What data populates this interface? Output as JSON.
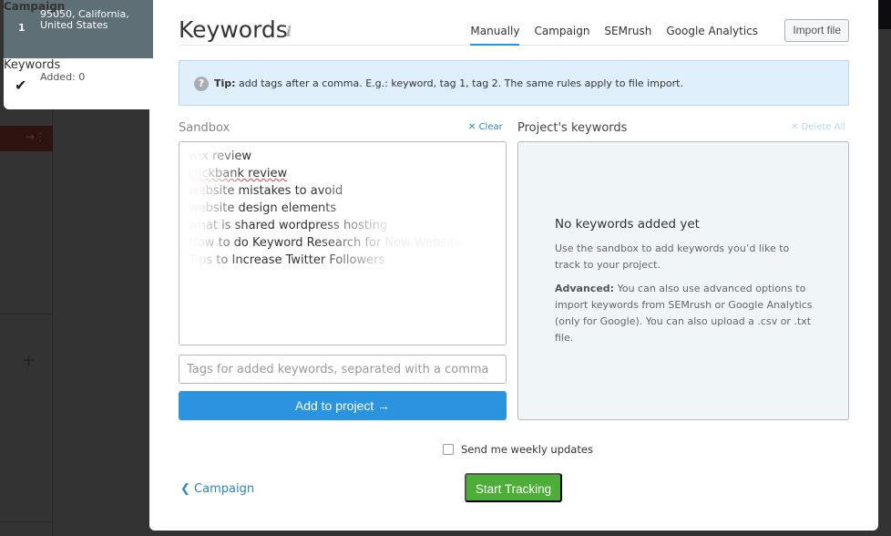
{
  "steps": [
    {
      "number": "1",
      "title": "Campaign",
      "subtitle_line1": "95050, California,",
      "subtitle_line2": "United States"
    },
    {
      "icon": "checkmark-icon",
      "title": "Keywords",
      "subtitle": "Added: 0"
    }
  ],
  "header": {
    "title": "Keywords",
    "info_icon": "i",
    "tabs": [
      {
        "label": "Manually",
        "active": true
      },
      {
        "label": "Campaign",
        "active": false
      },
      {
        "label": "SEMrush",
        "active": false
      },
      {
        "label": "Google Analytics",
        "active": false
      }
    ],
    "import_label": "Import file"
  },
  "tip": {
    "icon": "?",
    "bold": "Tip:",
    "text": " add tags after a comma. E.g.: keyword, tag 1, tag 2. The same rules apply to file import."
  },
  "sandbox": {
    "label": "Sandbox",
    "clear_label": "Clear",
    "keywords": [
      "wix review",
      "clickbank review",
      "website mistakes to avoid",
      "website design elements",
      "what is shared wordpress hosting",
      "How to do Keyword Research for New Website",
      "Tips to Increase Twitter Followers"
    ],
    "tags_placeholder": "Tags for added keywords, separated with a comma",
    "tags_value": "",
    "add_label": "Add to project",
    "add_icon": "→"
  },
  "project": {
    "label": "Project's keywords",
    "delete_all_label": "Delete All",
    "empty_title": "No keywords added yet",
    "empty_text": "Use the sandbox to add keywords you’d like to track to your project.",
    "advanced_bold": "Advanced:",
    "advanced_text": " You can also use advanced options to import keywords from SEMrush or Google Analytics (only for Google). You can also upload a .csv or .txt file."
  },
  "footer": {
    "weekly_label": "Send me weekly updates",
    "weekly_checked": false,
    "back_label": "Campaign",
    "start_label": "Start Tracking"
  },
  "colors": {
    "accent_blue": "#2b94e1",
    "start_green": "#4cae37",
    "step_active_bg": "#5e6f76"
  }
}
